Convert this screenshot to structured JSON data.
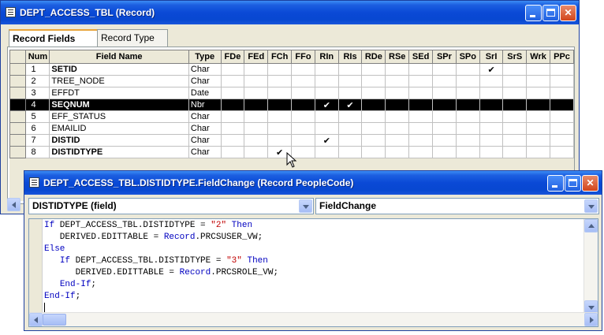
{
  "record_window": {
    "title": "DEPT_ACCESS_TBL (Record)",
    "tabs": [
      {
        "label": "Record Fields",
        "active": true
      },
      {
        "label": "Record Type",
        "active": false
      }
    ],
    "columns": [
      "Num",
      "Field Name",
      "Type",
      "FDe",
      "FEd",
      "FCh",
      "FFo",
      "RIn",
      "RIs",
      "RDe",
      "RSe",
      "SEd",
      "SPr",
      "SPo",
      "SrI",
      "SrS",
      "Wrk",
      "PPc"
    ],
    "rows": [
      {
        "num": "1",
        "field": "SETID",
        "bold": true,
        "type": "Char",
        "checks": [
          "SrI"
        ]
      },
      {
        "num": "2",
        "field": "TREE_NODE",
        "bold": false,
        "type": "Char",
        "checks": []
      },
      {
        "num": "3",
        "field": "EFFDT",
        "bold": false,
        "type": "Date",
        "checks": []
      },
      {
        "num": "4",
        "field": "SEQNUM",
        "bold": true,
        "type": "Nbr",
        "checks": [
          "RIn",
          "RIs"
        ],
        "selected": true
      },
      {
        "num": "5",
        "field": "EFF_STATUS",
        "bold": false,
        "type": "Char",
        "checks": []
      },
      {
        "num": "6",
        "field": "EMAILID",
        "bold": false,
        "type": "Char",
        "checks": []
      },
      {
        "num": "7",
        "field": "DISTID",
        "bold": true,
        "type": "Char",
        "checks": [
          "RIn"
        ]
      },
      {
        "num": "8",
        "field": "DISTIDTYPE",
        "bold": true,
        "type": "Char",
        "checks": [
          "FCh"
        ]
      }
    ],
    "check_glyph": "✔"
  },
  "peoplecode_window": {
    "title": "DEPT_ACCESS_TBL.DISTIDTYPE.FieldChange (Record PeopleCode)",
    "field_combo": "DISTIDTYPE   (field)",
    "event_combo": "FieldChange",
    "code_lines": [
      [
        {
          "k": "kw",
          "t": "If"
        },
        {
          "t": " DEPT_ACCESS_TBL.DISTIDTYPE = "
        },
        {
          "k": "str",
          "t": "\"2\""
        },
        {
          "t": " "
        },
        {
          "k": "kw",
          "t": "Then"
        }
      ],
      [
        {
          "t": "   DERIVED.EDITTABLE = "
        },
        {
          "k": "kw",
          "t": "Record"
        },
        {
          "t": ".PRCSUSER_VW;"
        }
      ],
      [
        {
          "k": "kw",
          "t": "Else"
        }
      ],
      [
        {
          "t": "   "
        },
        {
          "k": "kw",
          "t": "If"
        },
        {
          "t": " DEPT_ACCESS_TBL.DISTIDTYPE = "
        },
        {
          "k": "str",
          "t": "\"3\""
        },
        {
          "t": " "
        },
        {
          "k": "kw",
          "t": "Then"
        }
      ],
      [
        {
          "t": "      DERIVED.EDITTABLE = "
        },
        {
          "k": "kw",
          "t": "Record"
        },
        {
          "t": ".PRCSROLE_VW;"
        }
      ],
      [
        {
          "t": "   "
        },
        {
          "k": "kw",
          "t": "End-If"
        },
        {
          "t": ";"
        }
      ],
      [
        {
          "k": "kw",
          "t": "End-If"
        },
        {
          "t": ";"
        }
      ],
      [
        {
          "t": ""
        }
      ]
    ]
  }
}
